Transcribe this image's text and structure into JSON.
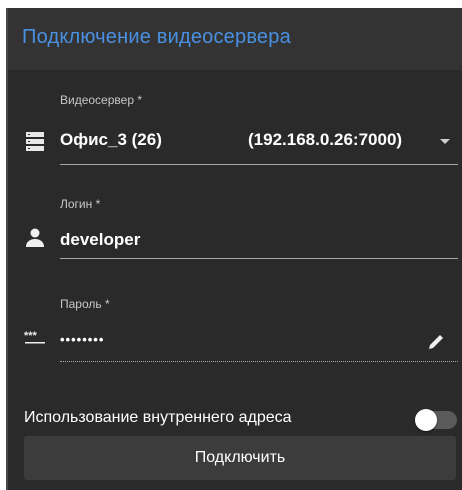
{
  "dialog": {
    "title": "Подключение видеосервера",
    "accent_color": "#4a90e2"
  },
  "server_field": {
    "label": "Видеосервер *",
    "icon": "server-icon",
    "name": "Офис_3 (26)",
    "address": "(192.168.0.26:7000)"
  },
  "login_field": {
    "label": "Логин *",
    "icon": "user-icon",
    "value": "developer"
  },
  "password_field": {
    "label": "Пароль *",
    "icon": "password-icon",
    "masked_value": "••••••••",
    "edit_icon": "pencil-icon"
  },
  "internal_address": {
    "label": "Использование внутреннего адреса",
    "enabled": false
  },
  "connect_button": {
    "label": "Подключить"
  }
}
